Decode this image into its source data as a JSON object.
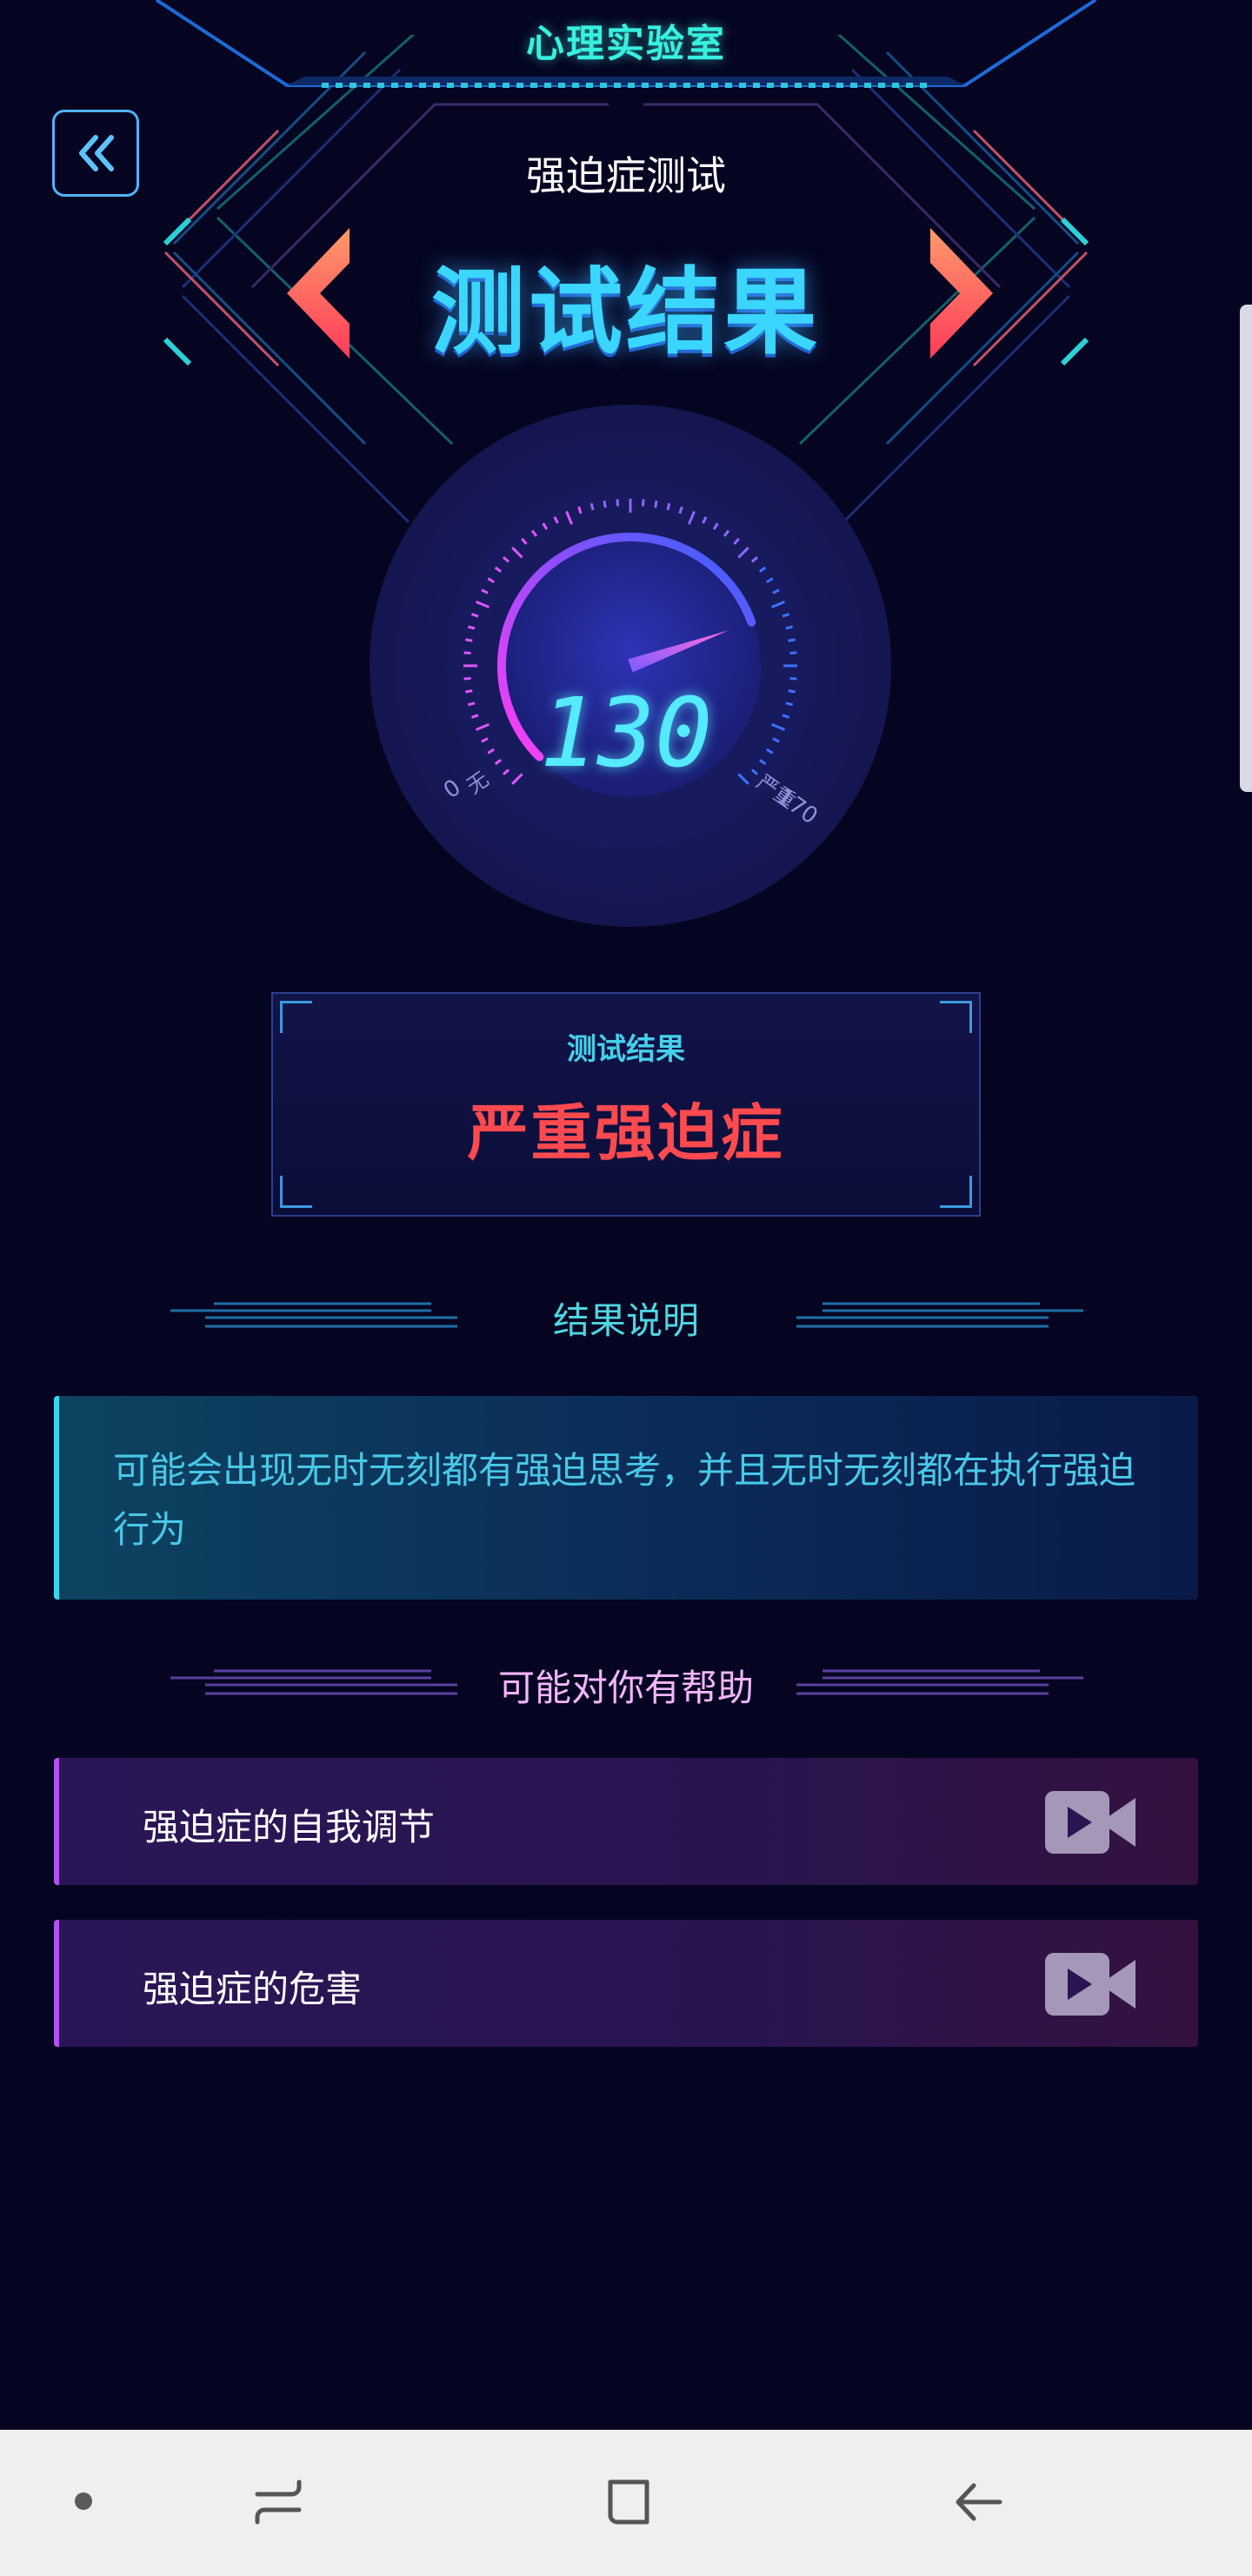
{
  "header": {
    "app_title": "心理实验室",
    "test_name": "强迫症测试",
    "hero_title": "测试结果"
  },
  "gauge": {
    "value": "130",
    "min": "0",
    "min_label": "无",
    "max": "170",
    "max_label": "严重",
    "fill_fraction": 0.76
  },
  "result": {
    "label": "测试结果",
    "value": "严重强迫症"
  },
  "explanation": {
    "heading": "结果说明",
    "text": "可能会出现无时无刻都有强迫思考，并且无时无刻都在执行强迫行为"
  },
  "help": {
    "heading": "可能对你有帮助",
    "items": [
      {
        "label": "强迫症的自我调节",
        "icon": "video-camera-icon"
      },
      {
        "label": "强迫症的危害",
        "icon": "video-camera-icon"
      }
    ]
  },
  "colors": {
    "background": "#050521",
    "accent_cyan": "#38f0e0",
    "result_red": "#ff4a4f",
    "help_purple": "#b451f2"
  },
  "nav": {
    "icons": [
      "dot-icon",
      "recent-apps-icon",
      "home-icon",
      "back-arrow-icon"
    ]
  }
}
